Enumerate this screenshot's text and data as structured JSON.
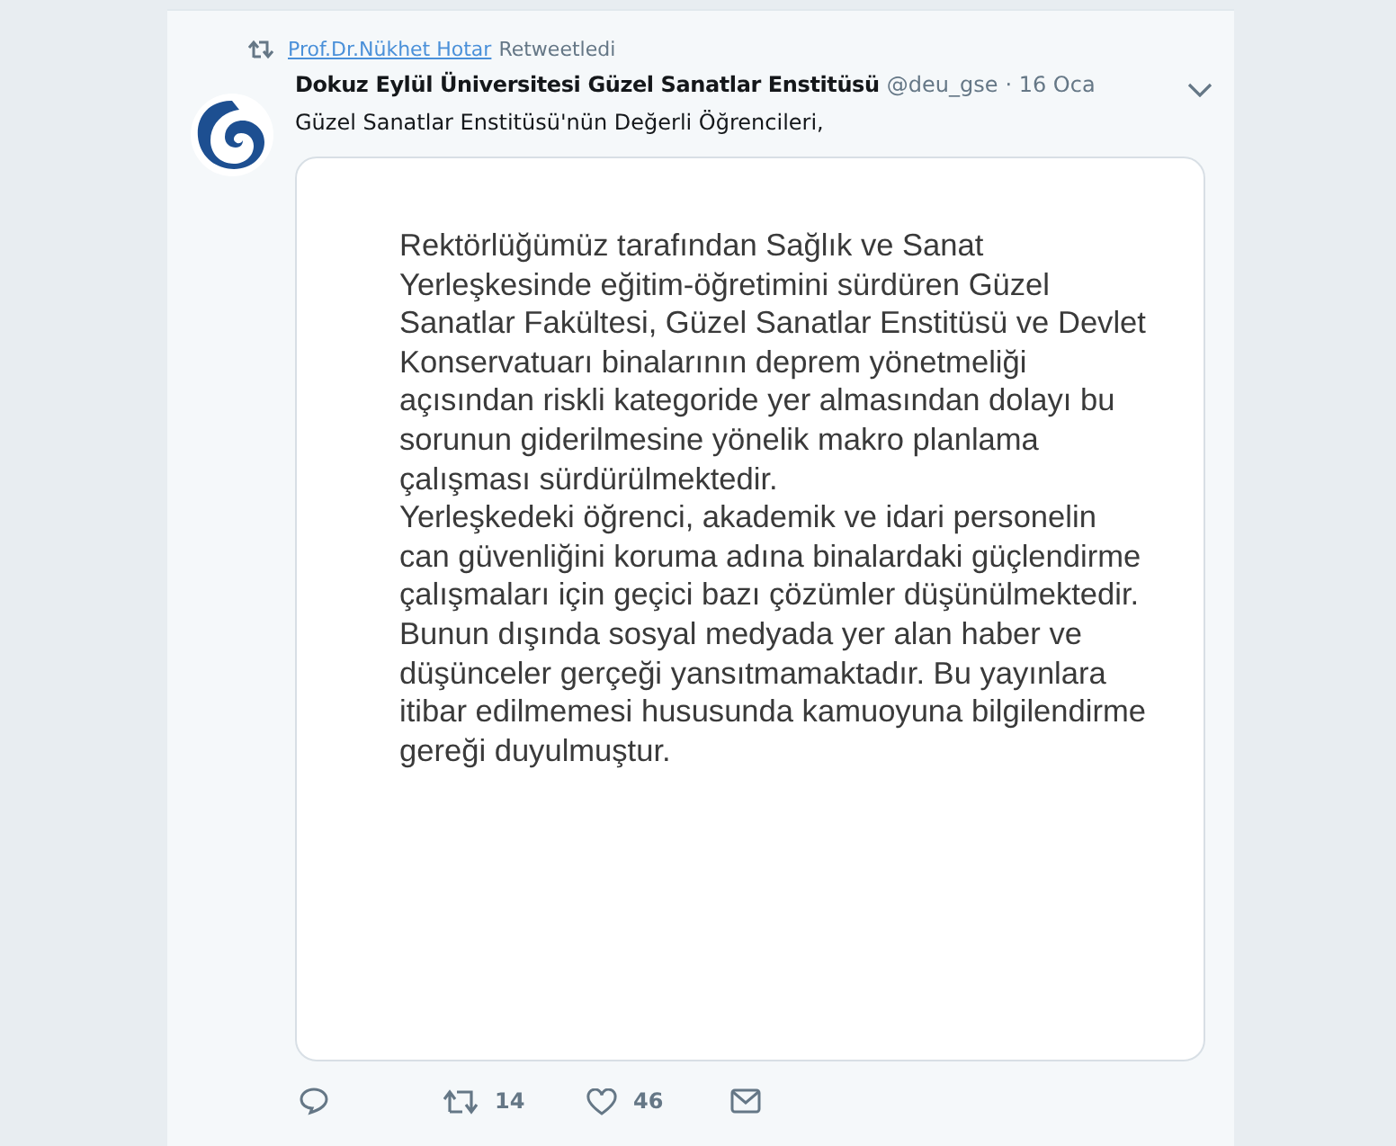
{
  "retweet": {
    "user": "Prof.Dr.Nükhet Hotar",
    "label": "Retweetledi"
  },
  "tweet": {
    "name": "Dokuz Eylül Üniversitesi Güzel Sanatlar Enstitüsü",
    "handle": "@deu_gse",
    "time": "· 16 Oca",
    "text": "Güzel Sanatlar Enstitüsü'nün Değerli Öğrencileri,",
    "image_lines": [
      "Rektörlüğümüz tarafından Sağlık ve Sanat",
      "Yerleşkesinde eğitim-öğretimini sürdüren Güzel",
      "Sanatlar Fakültesi, Güzel Sanatlar Enstitüsü ve Devlet",
      "Konservatuarı binalarının deprem yönetmeliği",
      "açısından riskli kategoride yer almasından dolayı bu",
      "sorunun giderilmesine yönelik makro planlama",
      "çalışması sürdürülmektedir.",
      "Yerleşkedeki öğrenci, akademik ve idari personelin",
      "can güvenliğini koruma adına binalardaki güçlendirme",
      "çalışmaları için geçici bazı çözümler düşünülmektedir.",
      "Bunun dışında sosyal medyada yer alan haber ve",
      "düşünceler gerçeği yansıtmamaktadır. Bu yayınlara",
      "itibar edilmemesi hususunda kamuoyuna bilgilendirme",
      "gereği duyulmuştur."
    ]
  },
  "actions": [
    {
      "kind": "reply"
    },
    {
      "kind": "retweet",
      "count": "14"
    },
    {
      "kind": "like",
      "count": "46"
    },
    {
      "kind": "message"
    }
  ]
}
